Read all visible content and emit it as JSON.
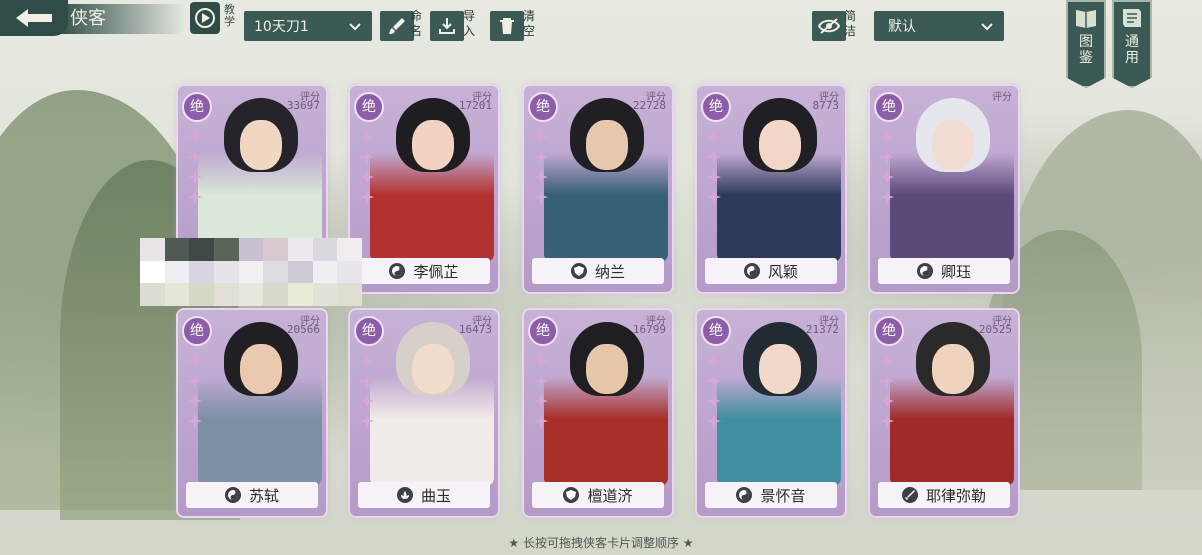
{
  "header": {
    "title": "侠客",
    "tutorial_label": "教学",
    "preset_value": "10天刀1",
    "rename_label": "命名",
    "import_label": "导入",
    "clear_label": "清空",
    "simple_label": "简洁",
    "sort_value": "默认",
    "codex_label": "图鉴",
    "general_label": "通用"
  },
  "score_label": "评分",
  "rank_label": "绝",
  "cards": [
    {
      "name": "",
      "score": "33697",
      "sect_icon": "bow-icon",
      "skin": "#f1d6c2",
      "robe": "#d9e8d8",
      "hair": "#24242a"
    },
    {
      "name": "李佩芷",
      "score": "17201",
      "sect_icon": "taiji-icon",
      "skin": "#f2d3c2",
      "robe": "#b2322f",
      "hair": "#1e1e22"
    },
    {
      "name": "纳兰",
      "score": "22728",
      "sect_icon": "shield-icon",
      "skin": "#e7c7ae",
      "robe": "#365f78",
      "hair": "#202024"
    },
    {
      "name": "风颖",
      "score": "8773",
      "sect_icon": "taiji-icon",
      "skin": "#f3d7c6",
      "robe": "#2d3b5a",
      "hair": "#1f1f25"
    },
    {
      "name": "卿珏",
      "score": "",
      "sect_icon": "taiji-icon",
      "skin": "#f2dcd4",
      "robe": "#5a4a7a",
      "hair": "#e6e6ee"
    },
    {
      "name": "苏轼",
      "score": "20566",
      "sect_icon": "taiji-icon",
      "skin": "#eac9b0",
      "robe": "#7d90a6",
      "hair": "#1f1f24"
    },
    {
      "name": "曲玉",
      "score": "16473",
      "sect_icon": "lotus-icon",
      "skin": "#f4dccb",
      "robe": "#f2ece8",
      "hair": "#d7cfc9"
    },
    {
      "name": "檀道济",
      "score": "16799",
      "sect_icon": "shield-icon",
      "skin": "#e8c6aa",
      "robe": "#a83028",
      "hair": "#1f1f22"
    },
    {
      "name": "景怀音",
      "score": "21372",
      "sect_icon": "taiji-icon",
      "skin": "#f1d8c9",
      "robe": "#3f8fa0",
      "hair": "#222a33"
    },
    {
      "name": "耶律弥勒",
      "score": "20525",
      "sect_icon": "sword-icon",
      "skin": "#f0d3bd",
      "robe": "#a02a2a",
      "hair": "#2a2a2a"
    }
  ],
  "footer_hint": "★ 长按可拖拽侠客卡片调整顺序 ★",
  "colors": {
    "accent_dark": "#2f4c48",
    "card_purple": "#b59ac9",
    "rank_purple": "#8c5ea8"
  }
}
